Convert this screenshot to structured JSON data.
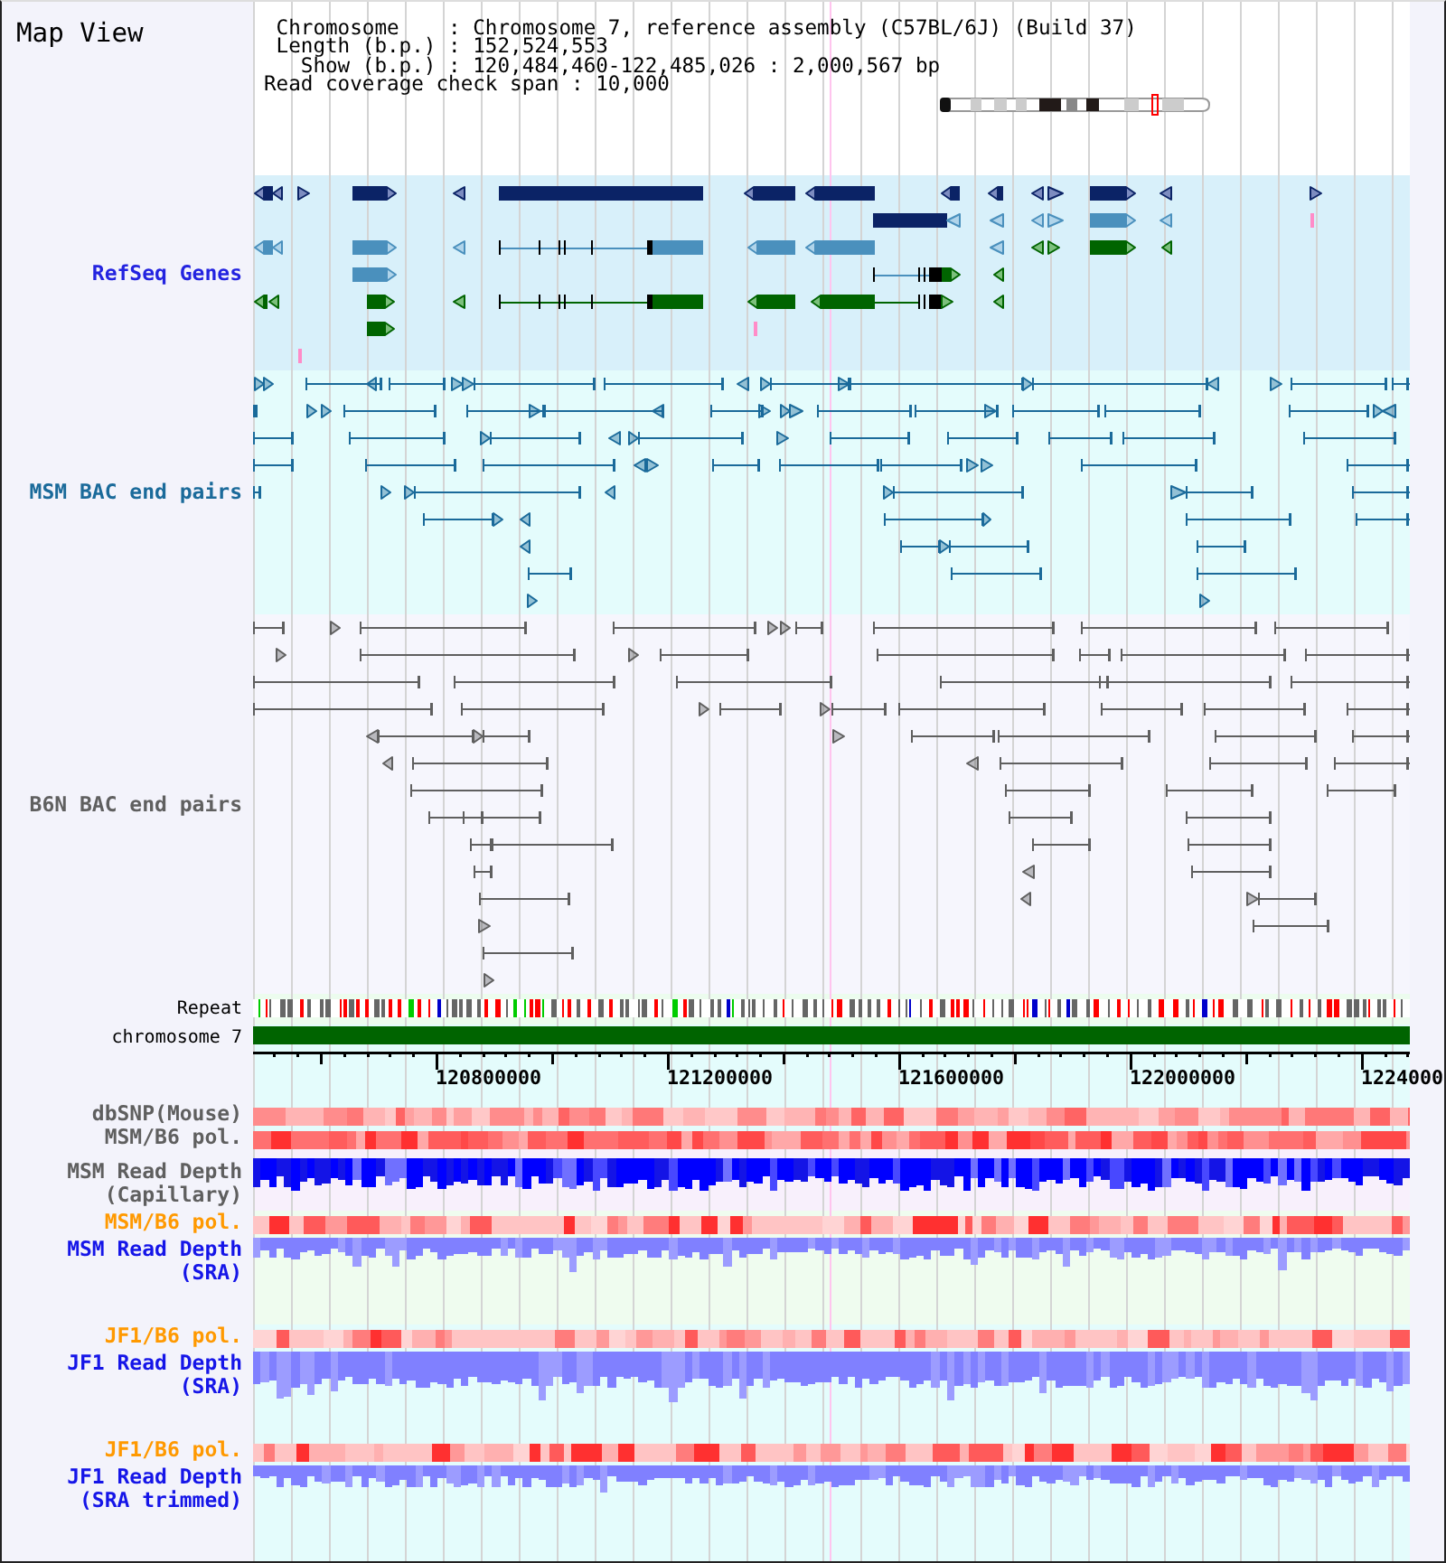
{
  "title": "Map View",
  "info": [
    {
      "kind": "field",
      "text": "Chromosome    : Chromosome 7, reference assembly (C57BL/6J) (Build 37)"
    },
    {
      "kind": "field",
      "text": "Length (b.p.) : 152,524,553"
    },
    {
      "kind": "field",
      "text": "  Show (b.p.) : 120,484,460-122,485,026 : 2,000,567 bp"
    },
    {
      "kind": "note",
      "text": "Read coverage check span : 10,000"
    }
  ],
  "tracks": [
    {
      "kind": "genes",
      "label": "RefSeq Genes",
      "color": "#2323e0"
    },
    {
      "kind": "bac_pairs",
      "label": "MSM BAC end pairs",
      "color": "#1a6a9a"
    },
    {
      "kind": "bac_pairs",
      "label": "B6N BAC end pairs",
      "color": "#5f5f5f"
    },
    {
      "kind": "repeat",
      "label": "Repeat",
      "color": "#000000"
    },
    {
      "kind": "chromosome",
      "label": "chromosome 7",
      "color": "#000000"
    },
    {
      "kind": "ruler",
      "ticks": [
        "120800000",
        "121200000",
        "121600000",
        "122000000",
        "1224000"
      ]
    },
    {
      "kind": "heatmap",
      "label": "dbSNP(Mouse)",
      "color": "#5f5f5f"
    },
    {
      "kind": "heatmap",
      "label": "MSM/B6 pol.",
      "color": "#5f5f5f"
    },
    {
      "kind": "coverage",
      "label": "MSM Read Depth (Capillary)",
      "color": "#5f5f5f"
    },
    {
      "kind": "heatmap",
      "label": "MSM/B6 pol.",
      "color": "#ff9900"
    },
    {
      "kind": "depth",
      "label": "MSM Read Depth (SRA)",
      "color": "#1515e8"
    },
    {
      "kind": "heatmap",
      "label": "JF1/B6 pol.",
      "color": "#ff9900"
    },
    {
      "kind": "depth",
      "label": "JF1 Read Depth (SRA)",
      "color": "#1515e8"
    },
    {
      "kind": "heatmap",
      "label": "JF1/B6 pol.",
      "color": "#ff9900"
    },
    {
      "kind": "depth",
      "label": "JF1 Read Depth (SRA trimmed)",
      "color": "#1515e8"
    }
  ]
}
